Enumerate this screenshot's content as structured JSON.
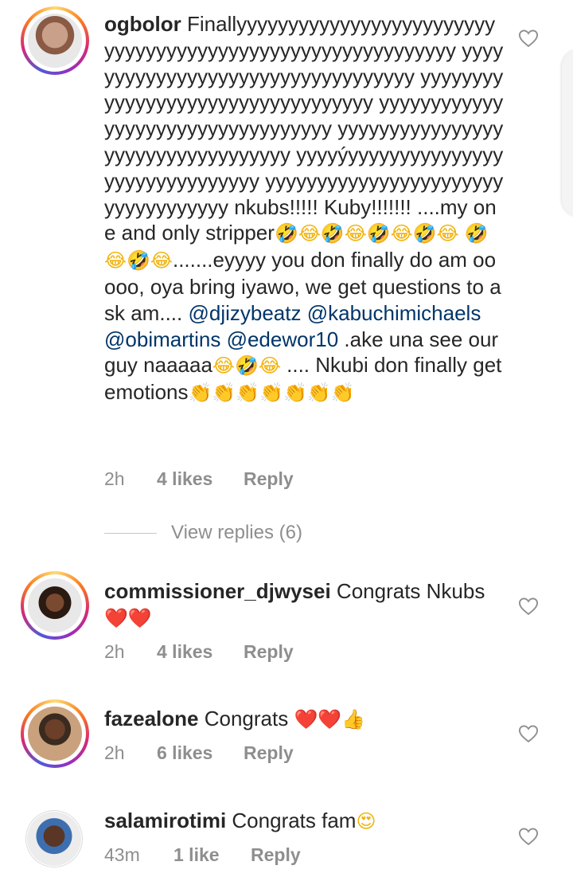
{
  "comments": [
    {
      "username": "ogbolor",
      "text_lines": [
        "Finallyyyyyyyyyyyyyyyyyyyyyyyyy",
        "yyyyyyyyyyyyyyyyyyyyyyyyyyyyyyyyyy",
        "yyyyyyyyyyyyyyyyyyyyyyyyyyyyyyyyyy",
        "yyyyyyyyyyyyyyyyyyyyyyyyyyyyyyyyyy",
        "yyyyyyyyyyyyyyyyyyyyyyyyyyyyyyyyyy",
        "yyyyyyyyyyyyyyyyyyyyyyyyyyyyyyyyyy",
        "yyyyýyyyyyyyyyyyyyyyyyyyyyyyyyyyyyy",
        "yyyyyyyyyyyyyyyyyyyyyyyyyyyyyyyyyyy",
        "nkubs!!!!! Kuby!!!!!!! ....my one and"
      ],
      "text_stripper": "only stripper",
      "emoji_row1": "🤣😂🤣😂🤣😂🤣😂",
      "emoji_row2": "🤣😂🤣😂",
      "text_eyyy": ".......eyyyy you don finally",
      "text_do": "do am ooooo, oya bring iyawo, we get",
      "text_questions": "questions to ask am....",
      "mention1": "@djizybeatz",
      "mention2": "@kabuchimichaels",
      "mention3": "@obimartins",
      "mention4": "@edewor10",
      "text_ake": ".ake una see our guy",
      "text_naaaa": "naaaaa",
      "emoji_naaaa": "😂🤣😂",
      "text_nkubi": ".... Nkubi don finally",
      "text_get": "get emotions",
      "emoji_clap": "👏👏👏👏👏👏👏",
      "time": "2h",
      "likes": "4 likes",
      "reply": "Reply"
    },
    {
      "username": "commissioner_djwysei",
      "text": "Congrats Nkubs",
      "emoji": "❤️❤️",
      "time": "2h",
      "likes": "4 likes",
      "reply": "Reply"
    },
    {
      "username": "fazealone",
      "text": "Congrats",
      "emoji": "❤️❤️👍",
      "time": "2h",
      "likes": "6 likes",
      "reply": "Reply"
    },
    {
      "username": "salamirotimi",
      "text": "Congrats fam",
      "emoji": "😍",
      "time": "43m",
      "likes": "1 like",
      "reply": "Reply"
    }
  ],
  "view_replies": "View replies (6)",
  "icons": {
    "like": "heart-outline-icon"
  },
  "colors": {
    "mention": "#003569",
    "meta": "#8e8e8e",
    "text": "#262626"
  }
}
